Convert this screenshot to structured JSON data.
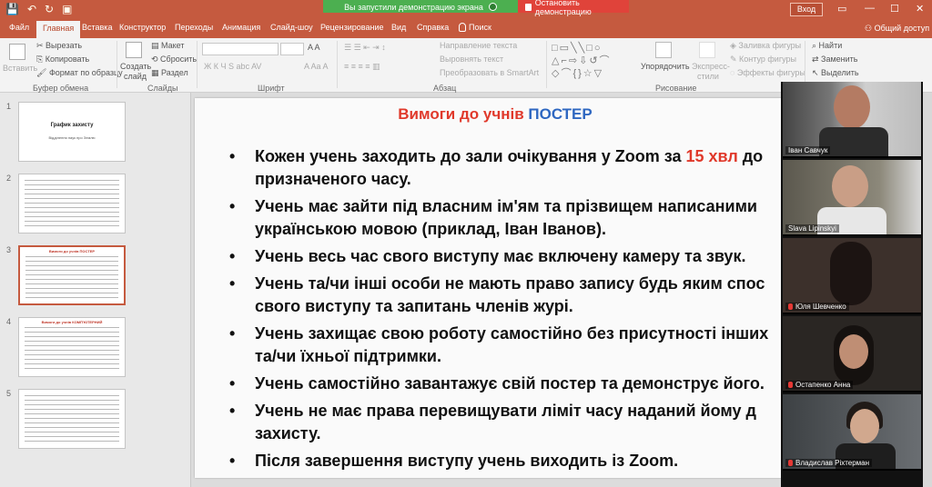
{
  "titlebar": {
    "banner_sharing": "Вы запустили демонстрацию экрана",
    "banner_stop": "Остановить демонстрацию",
    "signin": "Вход",
    "qat_icons": [
      "save-icon",
      "undo-icon",
      "redo-icon",
      "start-slideshow-icon"
    ]
  },
  "tabs": [
    "Файл",
    "Главная",
    "Вставка",
    "Конструктор",
    "Переходы",
    "Анимация",
    "Слайд-шоу",
    "Рецензирование",
    "Вид",
    "Справка"
  ],
  "active_tab": "Главная",
  "tell_me": "Поиск",
  "share": "Общий доступ",
  "ribbon": {
    "clipboard": {
      "paste": "Вставить",
      "cut": "Вырезать",
      "copy": "Копировать",
      "format_painter": "Формат по образцу",
      "label": "Буфер обмена"
    },
    "slides": {
      "new_slide": "Создать",
      "new_slide_2": "слайд",
      "layout": "Макет",
      "reset": "Сбросить",
      "section": "Раздел",
      "label": "Слайды"
    },
    "font": {
      "label": "Шрифт",
      "styles": "Ж  К  Ч  S  abc  AV",
      "color_row": "A  Aa  A"
    },
    "paragraph": {
      "text_direction": "Направление текста",
      "align_text": "Выровнять текст",
      "smartart": "Преобразовать в SmartArt",
      "label": "Абзац"
    },
    "drawing": {
      "arrange": "Упорядочить",
      "quick_styles": "Экспресс-",
      "quick_styles_2": "стили",
      "fill": "Заливка фигуры",
      "outline": "Контур фигуры",
      "effects": "Эффекты фигуры",
      "label": "Рисование",
      "shapes_glyphs": "□▭╲╲□○\n△⌐⇨⇩↺⌒\n◇⌒{}☆▽"
    },
    "editing": {
      "find": "Найти",
      "replace": "Заменить",
      "select": "Выделить"
    }
  },
  "slide_numbers": [
    "1",
    "2",
    "3",
    "4",
    "5"
  ],
  "thumbnails": [
    {
      "title": "График захисту",
      "subtitle": "Відділення наук про Землю"
    },
    {
      "title": "",
      "subtitle": ""
    },
    {
      "title": "Вимоги до учнів ПОСТЕР",
      "subtitle": ""
    },
    {
      "title": "Вимоги до учнів КОМП'ЮТЕРНИЙ",
      "subtitle": ""
    },
    {
      "title": "",
      "subtitle": ""
    }
  ],
  "slide": {
    "title_part1": "Вимоги до учнів ",
    "title_part2": "ПОСТЕР",
    "bullets": [
      {
        "line1_a": "Кожен учень заходить до зали очікування у Zoom за ",
        "line1_red": "15 хвл",
        "line1_b": " до",
        "line2": "призначеного часу."
      },
      {
        "line1_a": "Учень має зайти під власним ім'ям та прізвищем написаними",
        "line1_red": "",
        "line1_b": "",
        "line2": "українською мовою (приклад, Іван Іванов)."
      },
      {
        "line1_a": "Учень весь час свого виступу має включену камеру та звук.",
        "line1_red": "",
        "line1_b": "",
        "line2": ""
      },
      {
        "line1_a": "Учень та/чи інші особи не мають право запису будь яким спос",
        "line1_red": "",
        "line1_b": "",
        "line2": "свого виступу та запитань членів журі."
      },
      {
        "line1_a": "Учень захищає свою роботу самостійно без присутності інших",
        "line1_red": "",
        "line1_b": "",
        "line2": "та/чи їхньої підтримки."
      },
      {
        "line1_a": "Учень самостійно завантажує свій постер та демонструє його.",
        "line1_red": "",
        "line1_b": "",
        "line2": ""
      },
      {
        "line1_a": "Учень не має права перевищувати ліміт часу наданий йому д",
        "line1_red": "",
        "line1_b": "",
        "line2": "захисту."
      },
      {
        "line1_a": "Після завершення виступу учень виходить із Zoom.",
        "line1_red": "",
        "line1_b": "",
        "line2": ""
      }
    ]
  },
  "participants": [
    {
      "name": "Іван Савчук",
      "muted": false,
      "bg": "#8a8f8c",
      "face": "#b47b63"
    },
    {
      "name": "Slava Lipinskyi",
      "muted": false,
      "bg": "#6e6b5f",
      "face": "#c99e86"
    },
    {
      "name": "Юля Шевченко",
      "muted": true,
      "bg": "#3c302b",
      "face": "#c49679"
    },
    {
      "name": "Остапенко Анна",
      "muted": true,
      "bg": "#2a2623",
      "face": "#bf8e74"
    },
    {
      "name": "Владислав Ріхтерман",
      "muted": true,
      "bg": "#4a4e52",
      "face": "#d1a88e"
    }
  ],
  "colors": {
    "accent": "#c55a3f",
    "highlight_red": "#e0392b",
    "title_blue": "#2e67c1"
  }
}
